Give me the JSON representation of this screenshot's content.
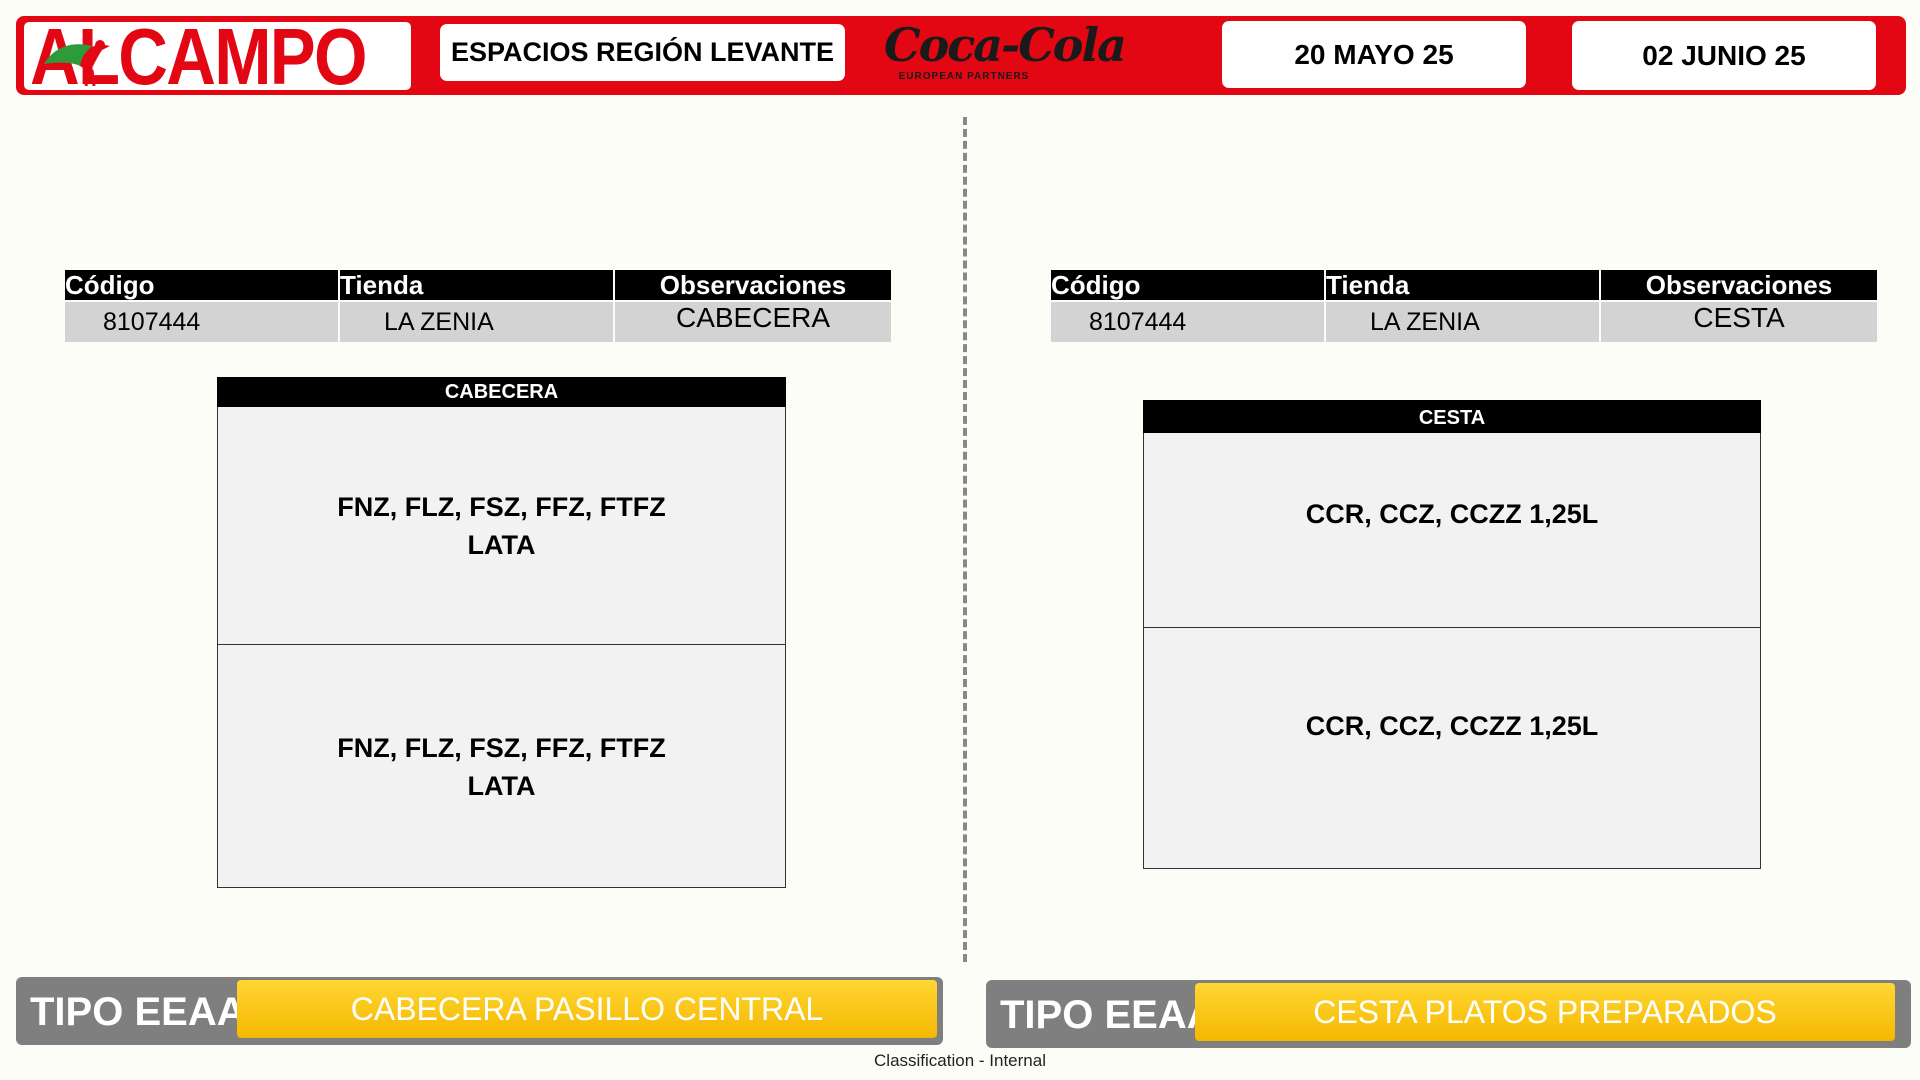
{
  "header": {
    "logo_text": "LCAMPO",
    "logo_a": "A",
    "region": "ESPACIOS REGIÓN LEVANTE",
    "brand_script": "Coca-Cola",
    "brand_sub": "EUROPEAN PARTNERS",
    "start_date": "20 MAYO 25",
    "end_date": "02 JUNIO 25",
    "colors": {
      "brand_red": "#e30613",
      "accent_yellow": "#f5b800",
      "bar_gray": "#7f7f7f"
    }
  },
  "left": {
    "table": {
      "headers": [
        "Código",
        "Tienda",
        "Observaciones"
      ],
      "row": [
        "8107444",
        "LA ZENIA",
        "CABECERA"
      ]
    },
    "shelf": {
      "title": "CABECERA",
      "sections": [
        {
          "line1": "FNZ, FLZ, FSZ, FFZ, FTFZ",
          "line2": "LATA"
        },
        {
          "line1": "FNZ, FLZ, FSZ, FFZ, FTFZ",
          "line2": "LATA"
        }
      ]
    },
    "type_label": "TIPO EEAA",
    "type_value": "CABECERA PASILLO CENTRAL"
  },
  "right": {
    "table": {
      "headers": [
        "Código",
        "Tienda",
        "Observaciones"
      ],
      "row": [
        "8107444",
        "LA ZENIA",
        "CESTA"
      ]
    },
    "shelf": {
      "title": "CESTA",
      "sections": [
        {
          "line1": "CCR, CCZ, CCZZ 1,25L"
        },
        {
          "line1": "CCR, CCZ, CCZZ 1,25L"
        }
      ]
    },
    "type_label": "TIPO EEAA",
    "type_value": "CESTA PLATOS PREPARADOS"
  },
  "footer": {
    "classification": "Classification - Internal"
  }
}
